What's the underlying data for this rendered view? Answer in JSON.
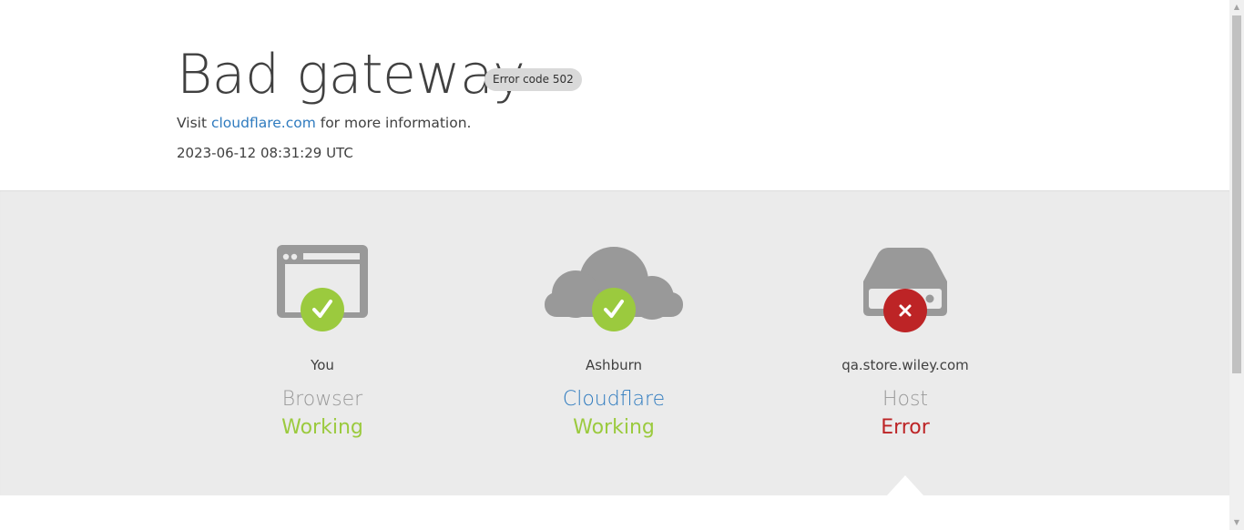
{
  "header": {
    "title": "Bad gateway",
    "error_badge": "Error code 502",
    "visit_prefix": "Visit ",
    "visit_link": "cloudflare.com",
    "visit_suffix": " for more information.",
    "timestamp": "2023-06-12 08:31:29 UTC"
  },
  "status": [
    {
      "location": "You",
      "node": "Browser",
      "state": "Working",
      "icon": "browser-icon",
      "badge": "check"
    },
    {
      "location": "Ashburn",
      "node": "Cloudflare",
      "state": "Working",
      "icon": "cloud-icon",
      "badge": "check"
    },
    {
      "location": "qa.store.wiley.com",
      "node": "Host",
      "state": "Error",
      "icon": "server-icon",
      "badge": "x"
    }
  ],
  "colors": {
    "ok": "#9bca3e",
    "error": "#bd2426",
    "link": "#2f7bbf",
    "icon_gray": "#999999",
    "band": "#ebebeb"
  }
}
